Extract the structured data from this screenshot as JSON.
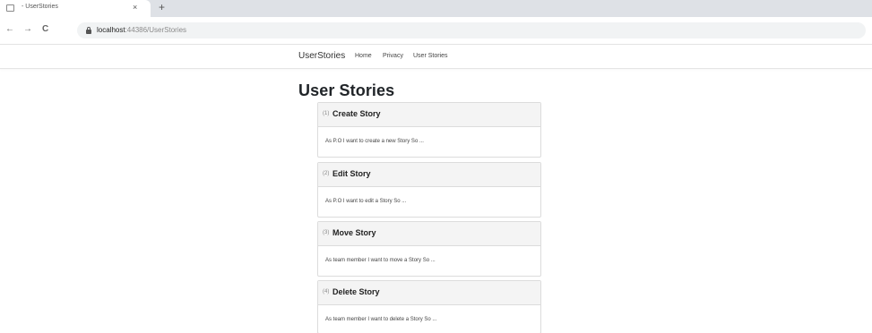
{
  "browser": {
    "tab_title": "- UserStories",
    "tab_close": "×",
    "new_tab": "+",
    "back": "←",
    "forward": "→",
    "reload": "C",
    "url_host": "localhost",
    "url_path": ":44386/UserStories"
  },
  "navbar": {
    "brand": "UserStories",
    "links": [
      "Home",
      "Privacy",
      "User Stories"
    ]
  },
  "page": {
    "title": "User Stories"
  },
  "stories": [
    {
      "num": "(1)",
      "title": "Create Story",
      "text": "As P.O I want to create a new Story So ..."
    },
    {
      "num": "(2)",
      "title": "Edit Story",
      "text": "As P.O I want to edit a Story So ..."
    },
    {
      "num": "(3)",
      "title": "Move Story",
      "text": "As team member I want to move a Story So ..."
    },
    {
      "num": "(4)",
      "title": "Delete Story",
      "text": "As team member I want to delete a Story So ..."
    }
  ]
}
